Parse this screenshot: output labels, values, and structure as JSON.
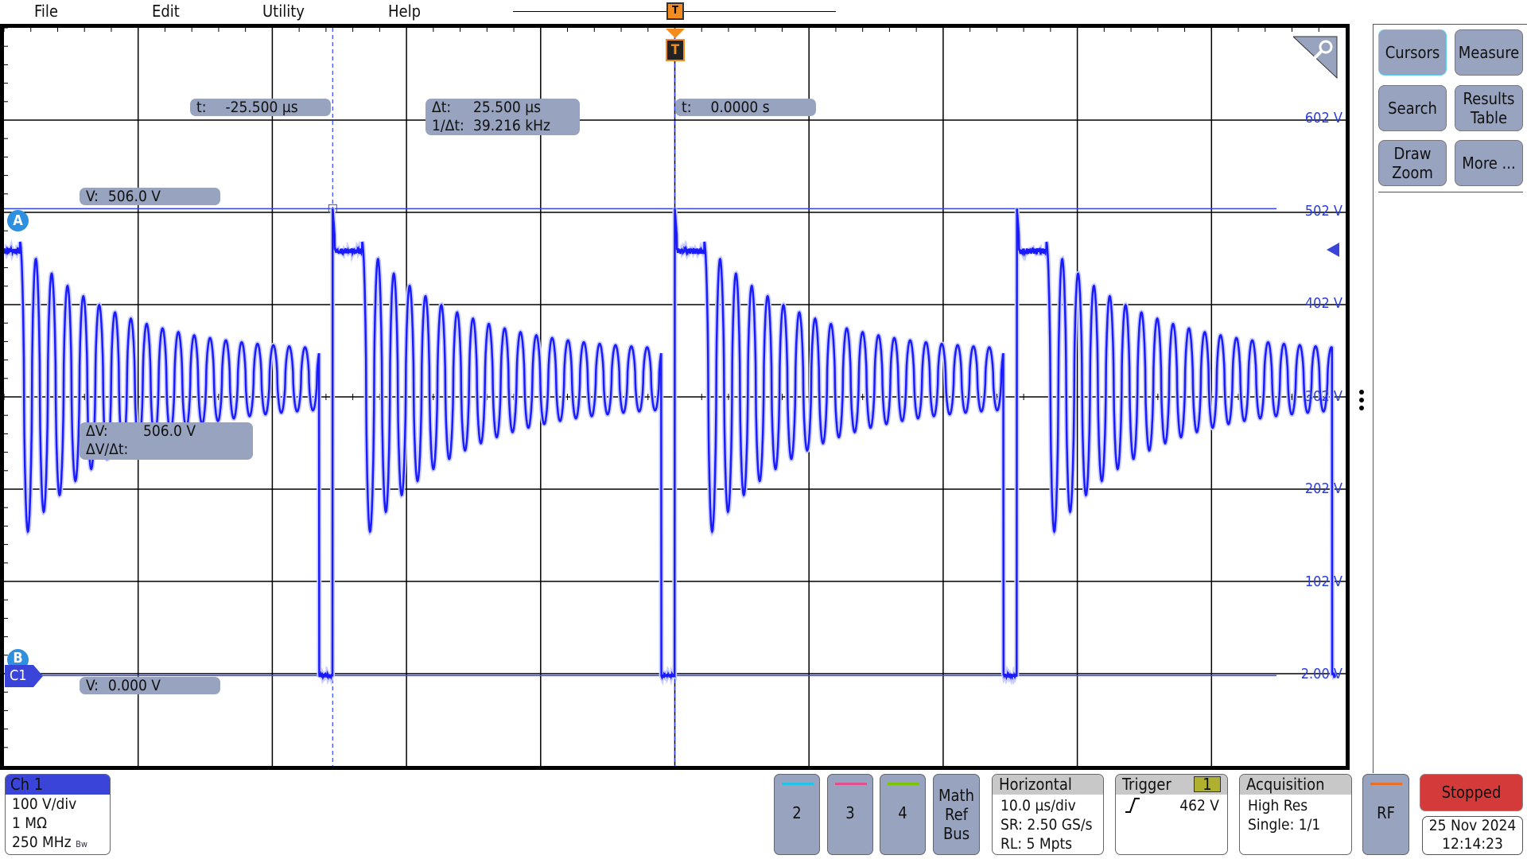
{
  "menu": {
    "items": [
      "File",
      "Edit",
      "Utility",
      "Help"
    ]
  },
  "trigger_marker": {
    "label": "T"
  },
  "cursors": {
    "a_time": {
      "label": "t:",
      "value": "-25.500 µs"
    },
    "delta": {
      "dt_label": "Δt:",
      "dt_value": "25.500 µs",
      "inv_label": "1/Δt:",
      "inv_value": "39.216 kHz"
    },
    "b_time": {
      "label": "t:",
      "value": "0.0000 s"
    },
    "a_volt": {
      "label": "V:",
      "value": "506.0 V"
    },
    "dv": {
      "dv_label": "ΔV:",
      "dv_value": "506.0 V",
      "dvdt_label": "ΔV/Δt:",
      "dvdt_value": ""
    },
    "b_volt": {
      "label": "V:",
      "value": "0.000 V"
    },
    "a_badge": "A",
    "b_badge": "B"
  },
  "channel_marker": "C1",
  "y_labels": [
    "602 V",
    "502 V",
    "402 V",
    "302 V",
    "202 V",
    "102 V",
    "2.00 V"
  ],
  "chart_data": {
    "type": "line",
    "xlabel": "",
    "ylabel": "",
    "x_unit": "µs",
    "xlim": [
      -50,
      50
    ],
    "y_unit": "V",
    "ylim": [
      -98,
      702
    ],
    "grid": true,
    "color": "#1a1aff",
    "pulse_rise_times_us": [
      -25.5,
      0,
      25.5
    ],
    "pulse_fall_times_us": [
      -26.5,
      -1,
      24.5,
      49
    ],
    "peak_v": 506,
    "plateau_v": 460,
    "low_v": 0,
    "cursor_a": {
      "t_us": -25.5,
      "v": 506
    },
    "cursor_b": {
      "t_us": 0,
      "v": 0
    },
    "trigger_level_v": 462
  },
  "side": {
    "buttons": [
      "Cursors",
      "Measure",
      "Search",
      "Results Table",
      "Draw Zoom",
      "More ..."
    ]
  },
  "ch1": {
    "title": "Ch 1",
    "scale": "100 V/div",
    "impedance": "1 MΩ",
    "bandwidth": "250 MHz",
    "bw_icon": "Bw"
  },
  "channels": [
    {
      "label": "2",
      "color": "#22c3e6"
    },
    {
      "label": "3",
      "color": "#e0508e"
    },
    {
      "label": "4",
      "color": "#7cc400"
    }
  ],
  "math": [
    "Math",
    "Ref",
    "Bus"
  ],
  "horizontal": {
    "title": "Horizontal",
    "scale": "10.0 µs/div",
    "sr": "SR: 2.50 GS/s",
    "rl": "RL: 5 Mpts"
  },
  "trigger": {
    "title": "Trigger",
    "source": "1",
    "level": "462 V",
    "slope_icon": "rising-edge"
  },
  "acquisition": {
    "title": "Acquisition",
    "mode": "High Res",
    "single": "Single: 1/1"
  },
  "rf": {
    "label": "RF",
    "color": "#e8702a"
  },
  "status": {
    "label": "Stopped",
    "color": "#d43a3a"
  },
  "datetime": {
    "date": "25 Nov 2024",
    "time": "12:14:23"
  }
}
